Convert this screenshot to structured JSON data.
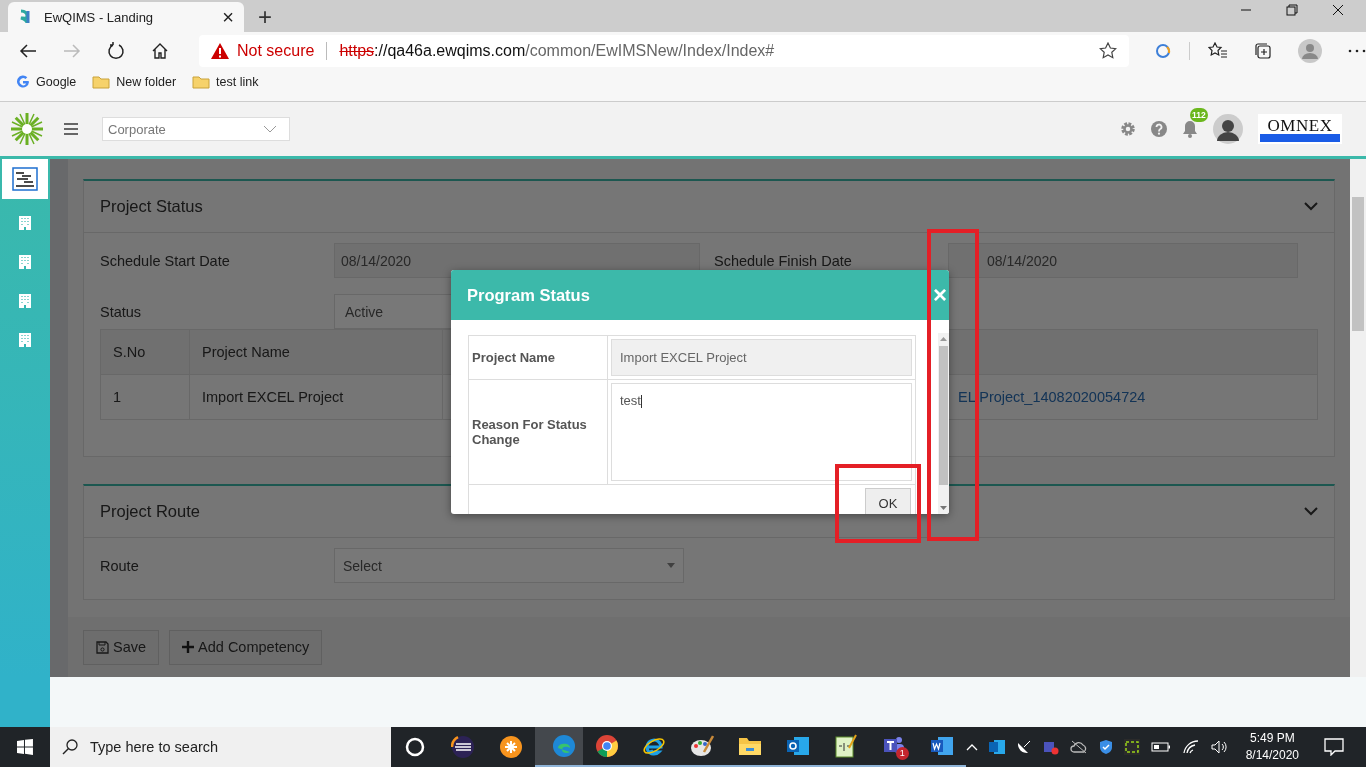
{
  "browser": {
    "tab": {
      "title": "EwQIMS - Landing",
      "close": "×",
      "new_tab": "+"
    },
    "address": {
      "security": "Not secure",
      "scheme": "https",
      "host": "://qa46a.ewqims.com",
      "path": "/common/EwIMSNew/Index/Index#"
    },
    "bookmarks": [
      {
        "label": "Google",
        "kind": "google"
      },
      {
        "label": "New folder",
        "kind": "folder"
      },
      {
        "label": "test link",
        "kind": "folder"
      }
    ]
  },
  "header": {
    "company_select": "Corporate",
    "notification_count": "112",
    "logo_text": "OMNEX"
  },
  "sidebar": {
    "items": [
      {
        "kind": "chart",
        "selected": true
      },
      {
        "kind": "building",
        "selected": false
      },
      {
        "kind": "building",
        "selected": false
      },
      {
        "kind": "building",
        "selected": false
      },
      {
        "kind": "building",
        "selected": false
      }
    ]
  },
  "project_status": {
    "title": "Project Status",
    "start_label": "Schedule Start Date",
    "start_value": "08/14/2020",
    "finish_label": "Schedule Finish Date",
    "finish_value": "08/14/2020",
    "status_label": "Status",
    "status_value": "Active",
    "table": {
      "columns": [
        "S.No",
        "Project Name"
      ],
      "rows": [
        {
          "sno": "1",
          "name": "Import EXCEL Project",
          "link": "EL Project_14082020054724"
        }
      ]
    }
  },
  "project_route": {
    "title": "Project Route",
    "route_label": "Route",
    "route_value": "Select"
  },
  "footer": {
    "buttons": [
      {
        "label": "Save",
        "kind": "save"
      },
      {
        "label": "Add Competency",
        "kind": "add"
      }
    ]
  },
  "modal": {
    "title": "Program Status",
    "close": "×",
    "rows": [
      {
        "label": "Project Name",
        "value": "Import EXCEL Project",
        "kind": "readonly"
      },
      {
        "label": "Reason For Status Change",
        "value": "test",
        "kind": "textarea"
      }
    ],
    "ok": "OK"
  },
  "taskbar": {
    "search_placeholder": "Type here to search",
    "apps": [
      {
        "kind": "ring",
        "selected": false,
        "running": false
      },
      {
        "kind": "striped",
        "selected": false,
        "running": false
      },
      {
        "kind": "flower",
        "selected": false,
        "running": false
      },
      {
        "kind": "wave",
        "selected": true,
        "running": true
      },
      {
        "kind": "chrome",
        "selected": false,
        "running": true
      },
      {
        "kind": "ie",
        "selected": false,
        "running": true
      },
      {
        "kind": "palette",
        "selected": false,
        "running": true
      },
      {
        "kind": "folder",
        "selected": false,
        "running": true
      },
      {
        "kind": "mail",
        "selected": false,
        "running": true
      },
      {
        "kind": "notepad",
        "selected": false,
        "running": true
      },
      {
        "kind": "team",
        "selected": false,
        "running": true,
        "badge": "1"
      },
      {
        "kind": "doc",
        "selected": false,
        "running": true
      }
    ],
    "time": "5:49 PM",
    "date": "8/14/2020"
  }
}
